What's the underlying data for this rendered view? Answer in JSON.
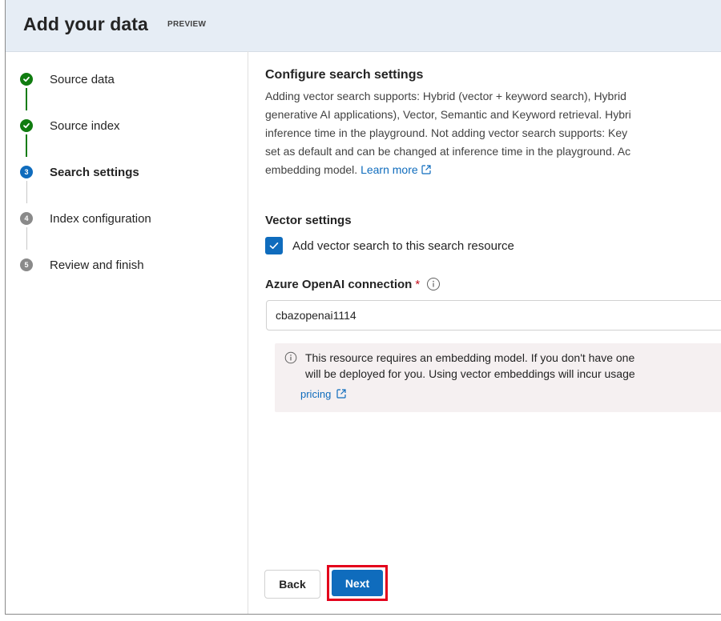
{
  "header": {
    "title": "Add your data",
    "badge": "PREVIEW"
  },
  "steps": [
    {
      "label": "Source data",
      "state": "done",
      "number": "1"
    },
    {
      "label": "Source index",
      "state": "done",
      "number": "2"
    },
    {
      "label": "Search settings",
      "state": "current",
      "number": "3"
    },
    {
      "label": "Index configuration",
      "state": "todo",
      "number": "4"
    },
    {
      "label": "Review and finish",
      "state": "todo",
      "number": "5"
    }
  ],
  "main": {
    "title": "Configure search settings",
    "description_lines": [
      "Adding vector search supports: Hybrid (vector + keyword search), Hybrid",
      "generative AI applications), Vector, Semantic and Keyword retrieval. Hybri",
      "inference time in the playground. Not adding vector search supports: Key",
      "set as default and can be changed at inference time in the playground. Ac",
      "embedding model."
    ],
    "learn_more": "Learn more",
    "vector_settings_title": "Vector settings",
    "checkbox_label": "Add vector search to this search resource",
    "checkbox_checked": true,
    "connection_label": "Azure OpenAI connection",
    "required_mark": "*",
    "connection_value": "cbazopenai1114",
    "note_lines": [
      "This resource requires an embedding model. If you don't have one",
      "will be deployed for you. Using vector embeddings will incur usage"
    ],
    "note_link": "pricing"
  },
  "buttons": {
    "back": "Back",
    "next": "Next"
  },
  "colors": {
    "accent": "#0f6cbd",
    "done": "#107c10",
    "highlight": "#e3001b",
    "header_bg": "#e6edf5"
  }
}
